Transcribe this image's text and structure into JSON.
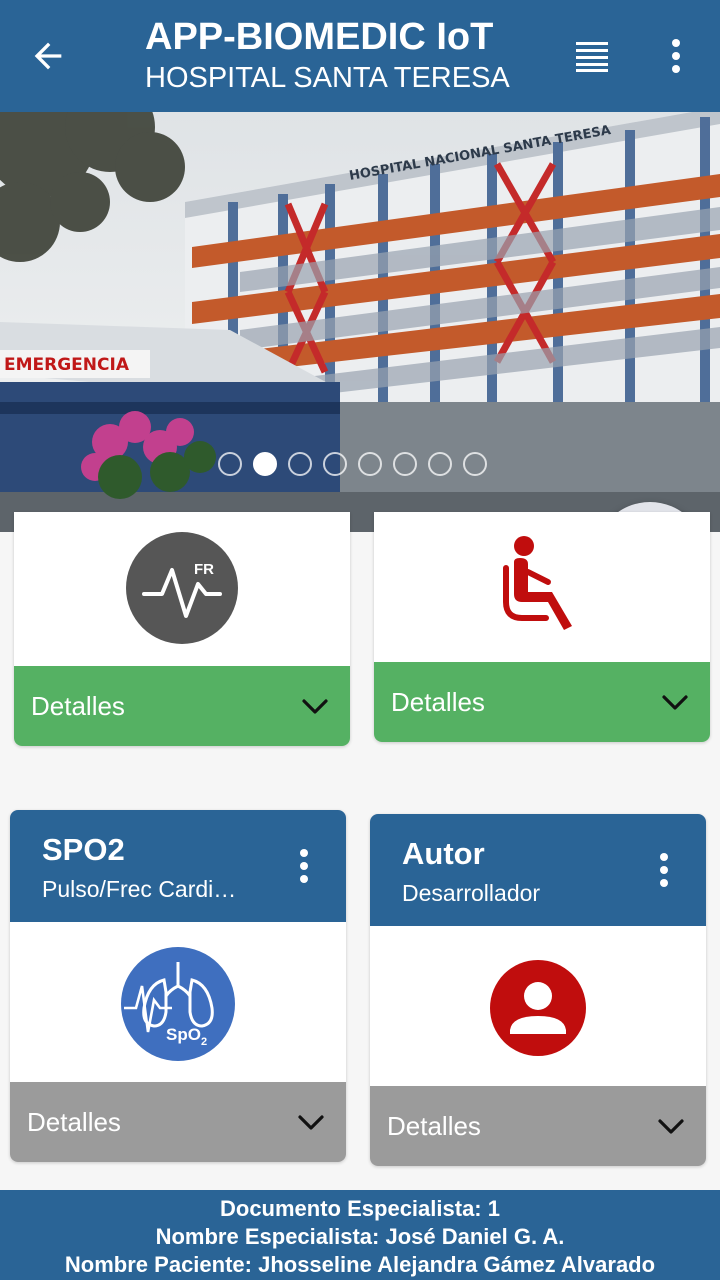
{
  "appbar": {
    "title": "APP-BIOMEDIC IoT",
    "subtitle": "HOSPITAL SANTA TERESA",
    "icons": [
      "arrow-back-icon",
      "list-icon",
      "more-vert-icon"
    ]
  },
  "banner": {
    "building_sign": "HOSPITAL NACIONAL SANTA TERESA",
    "emergency_sign": "EMERGENCIA",
    "carousel_count": 8,
    "active_index": 1,
    "fab_icon": "bluetooth-icon"
  },
  "cards": {
    "fr": {
      "icon": "fr-pulse-icon",
      "icon_text": "FR",
      "details_label": "Detalles"
    },
    "posture": {
      "icon": "seated-person-icon",
      "details_label": "Detalles"
    },
    "spo2": {
      "title": "SPO2",
      "subtitle": "Pulso/Frec Cardi…",
      "icon": "spo2-lungs-icon",
      "icon_text": "SpO",
      "icon_subscript": "2",
      "details_label": "Detalles"
    },
    "autor": {
      "title": "Autor",
      "subtitle": "Desarrollador",
      "icon": "account-circle-icon",
      "details_label": "Detalles"
    }
  },
  "footer": {
    "line1": "Documento Especialista: 1",
    "line2": "Nombre Especialista: José Daniel G. A.",
    "line3": "Nombre Paciente: Jhosseline Alejandra Gámez Alvarado"
  },
  "colors": {
    "primary": "#2a6496",
    "green": "#55b163",
    "gray": "#9b9b9b",
    "red": "#c00d0d",
    "fr_icon": "#565656"
  }
}
